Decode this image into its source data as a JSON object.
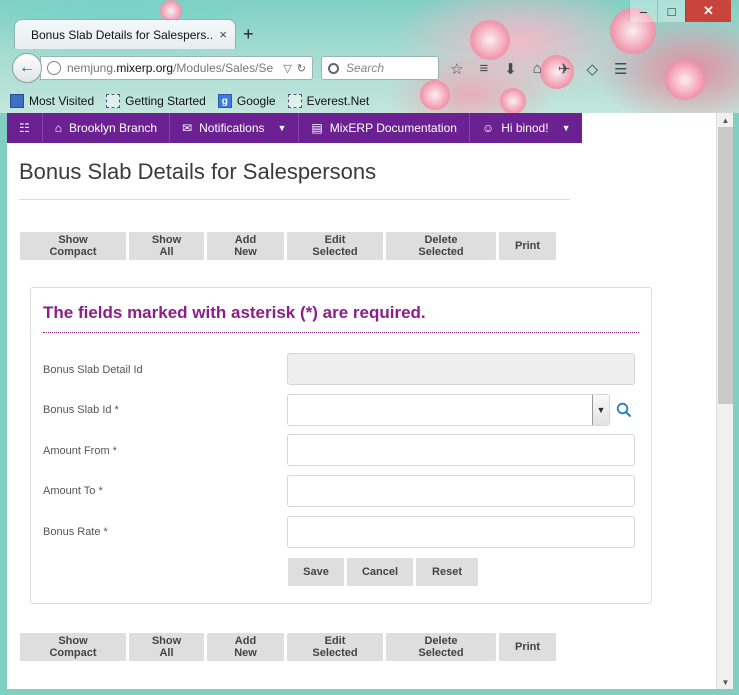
{
  "browser": {
    "tab_title": "Bonus Slab Details for Salespers...",
    "tab_close": "×",
    "new_tab": "+",
    "url_prefix": "nemjung.",
    "url_domain": "mixerp.org",
    "url_path": "/Modules/Sales/Se",
    "search_placeholder": "Search",
    "bookmarks": [
      "Most Visited",
      "Getting Started",
      "Google",
      "Everest.Net"
    ]
  },
  "topmenu": {
    "branch": "Brooklyn Branch",
    "notifications": "Notifications",
    "documentation": "MixERP Documentation",
    "greeting": "Hi binod!"
  },
  "page": {
    "title": "Bonus Slab Details for Salespersons"
  },
  "toolbar": {
    "show_compact": "Show Compact",
    "show_all": "Show All",
    "add_new": "Add New",
    "edit_selected": "Edit Selected",
    "delete_selected": "Delete Selected",
    "print": "Print"
  },
  "form": {
    "required_note": "The fields marked with asterisk (*) are required.",
    "fields": {
      "bonus_slab_detail_id": {
        "label": "Bonus Slab Detail Id",
        "value": ""
      },
      "bonus_slab_id": {
        "label": "Bonus Slab Id *",
        "value": ""
      },
      "amount_from": {
        "label": "Amount From *",
        "value": ""
      },
      "amount_to": {
        "label": "Amount To *",
        "value": ""
      },
      "bonus_rate": {
        "label": "Bonus Rate *",
        "value": ""
      }
    },
    "buttons": {
      "save": "Save",
      "cancel": "Cancel",
      "reset": "Reset"
    }
  },
  "colors": {
    "menu_bg": "#6c2193",
    "required_text": "#8a1f8a",
    "button_bg": "#dedede"
  }
}
